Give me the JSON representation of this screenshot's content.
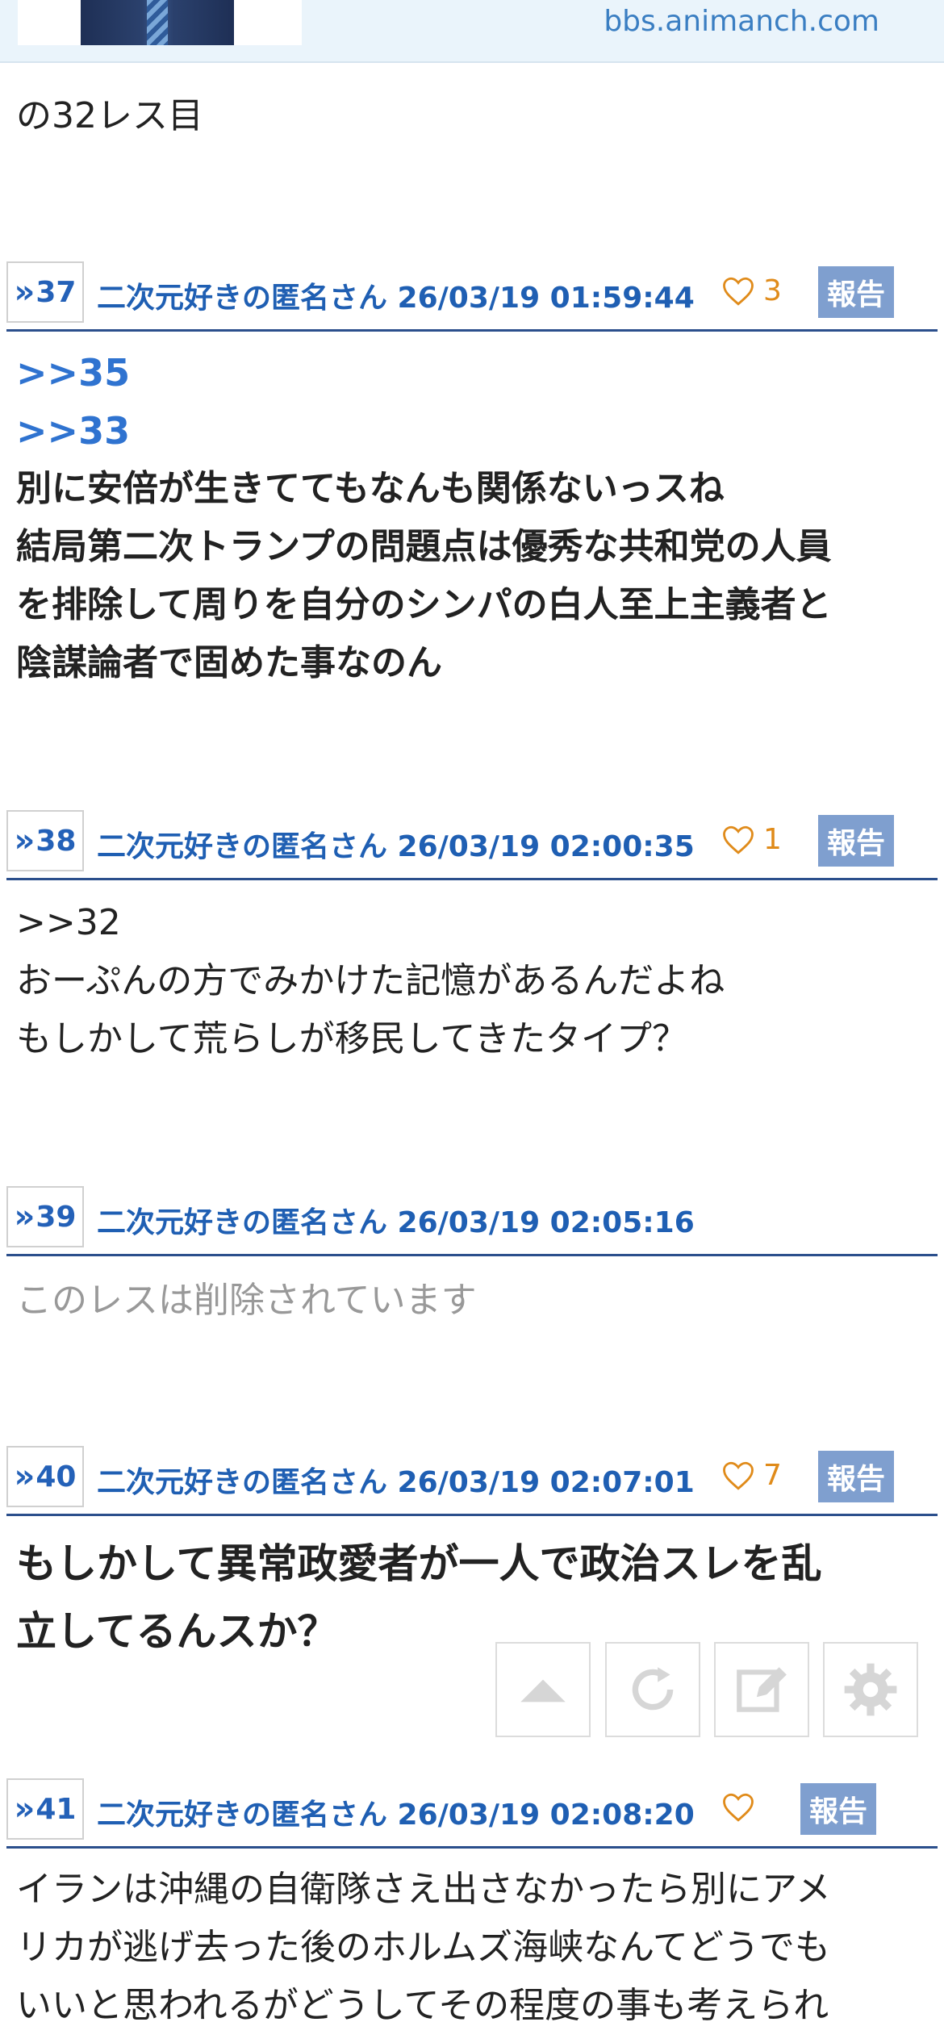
{
  "header": {
    "domain": "bbs.animanch.com"
  },
  "posts": [
    {
      "lines": [
        "の32レス目"
      ]
    },
    {
      "num": "37",
      "author": "二次元好きの匿名さん 26/03/19 01:59:44",
      "likes": "3",
      "report": "報告",
      "refs": [
        ">>35",
        ">>33"
      ],
      "lines": [
        "別に安倍が生きててもなんも関係ないっスね",
        "結局第二次トランプの問題点は優秀な共和党の人員",
        "を排除して周りを自分のシンパの白人至上主義者と",
        "陰謀論者で固めた事なのん"
      ]
    },
    {
      "num": "38",
      "author": "二次元好きの匿名さん 26/03/19 02:00:35",
      "likes": "1",
      "report": "報告",
      "refs": [
        ">>32"
      ],
      "lines": [
        "おーぷんの方でみかけた記憶があるんだよね",
        "もしかして荒らしが移民してきたタイプ？"
      ]
    },
    {
      "num": "39",
      "author": "二次元好きの匿名さん 26/03/19 02:05:16",
      "deleted": "このレスは削除されています"
    },
    {
      "num": "40",
      "author": "二次元好きの匿名さん 26/03/19 02:07:01",
      "likes": "7",
      "report": "報告",
      "lines": [
        "もしかして異常政愛者が一人で政治スレを乱",
        "立してるんスか？"
      ]
    },
    {
      "num": "41",
      "author": "二次元好きの匿名さん 26/03/19 02:08:20",
      "likes": "",
      "report": "報告",
      "lines": [
        "イランは沖縄の自衛隊さえ出さなかったら別にアメ",
        "リカが逃げ去った後のホルムズ海峡なんてどうでも",
        "いいと思われるがどうしてその程度の事も考えられ"
      ]
    }
  ],
  "toolbar": {
    "icons": [
      "scroll-top-icon",
      "reload-icon",
      "edit-icon",
      "settings-icon"
    ]
  }
}
